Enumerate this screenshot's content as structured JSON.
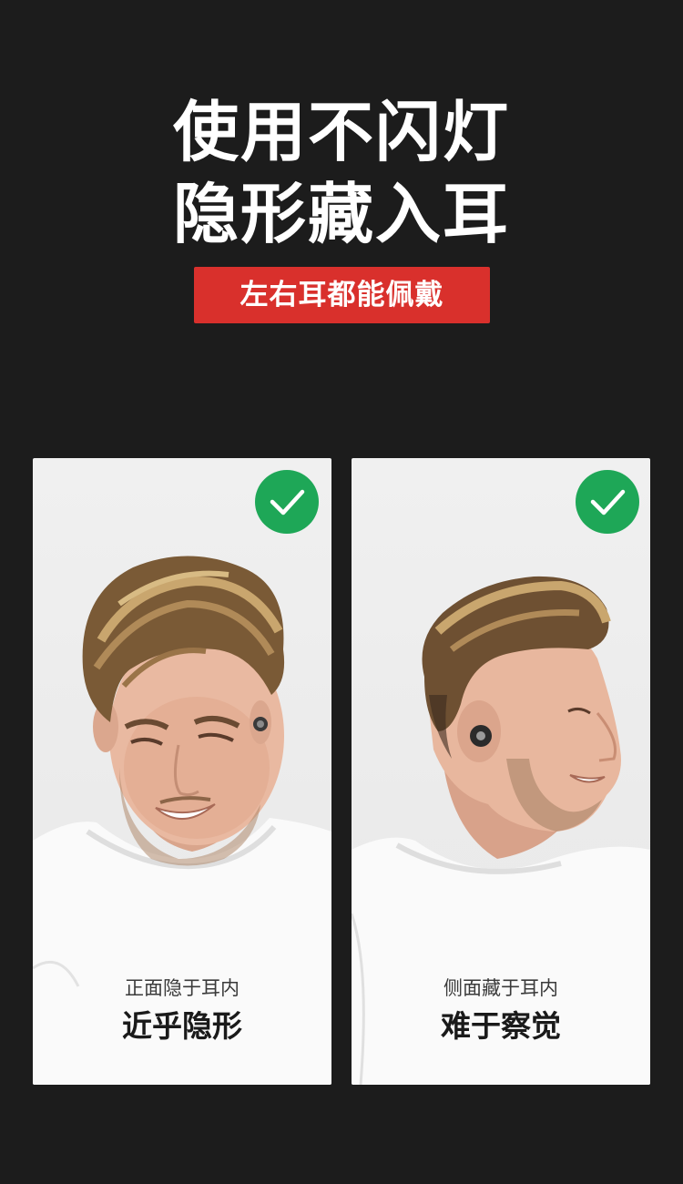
{
  "headline": {
    "line1": "使用不闪灯",
    "line2": "隐形藏入耳"
  },
  "badge": {
    "label": "左右耳都能佩戴"
  },
  "cards": [
    {
      "subtitle": "正面隐于耳内",
      "title": "近乎隐形",
      "icon": "check-icon"
    },
    {
      "subtitle": "侧面藏于耳内",
      "title": "难于察觉",
      "icon": "check-icon"
    }
  ],
  "colors": {
    "background": "#1c1c1c",
    "badge": "#d9302c",
    "check": "#1ea757"
  }
}
